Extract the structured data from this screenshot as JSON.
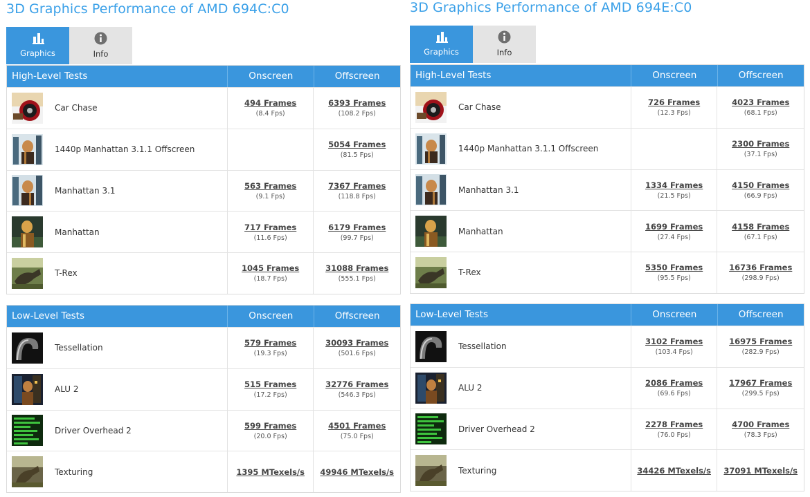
{
  "panels": [
    {
      "title": "3D Graphics Performance of AMD 694C:C0",
      "tabs": [
        {
          "label": "Graphics",
          "icon": "bar-chart-icon"
        },
        {
          "label": "Info",
          "icon": "info-icon"
        }
      ],
      "high": {
        "header": {
          "name": "High-Level Tests",
          "onscreen": "Onscreen",
          "offscreen": "Offscreen"
        },
        "rows": [
          {
            "name": "Car Chase",
            "thumb": "car-chase",
            "on": "494 Frames",
            "on_fps": "(8.4 Fps)",
            "off": "6393 Frames",
            "off_fps": "(108.2 Fps)"
          },
          {
            "name": "1440p Manhattan 3.1.1 Offscreen",
            "thumb": "manhattan311",
            "on": "",
            "on_fps": "",
            "off": "5054 Frames",
            "off_fps": "(81.5 Fps)"
          },
          {
            "name": "Manhattan 3.1",
            "thumb": "manhattan31",
            "on": "563 Frames",
            "on_fps": "(9.1 Fps)",
            "off": "7367 Frames",
            "off_fps": "(118.8 Fps)"
          },
          {
            "name": "Manhattan",
            "thumb": "manhattan",
            "on": "717 Frames",
            "on_fps": "(11.6 Fps)",
            "off": "6179 Frames",
            "off_fps": "(99.7 Fps)"
          },
          {
            "name": "T-Rex",
            "thumb": "trex",
            "on": "1045 Frames",
            "on_fps": "(18.7 Fps)",
            "off": "31088 Frames",
            "off_fps": "(555.1 Fps)"
          }
        ]
      },
      "low": {
        "header": {
          "name": "Low-Level Tests",
          "onscreen": "Onscreen",
          "offscreen": "Offscreen"
        },
        "rows": [
          {
            "name": "Tessellation",
            "thumb": "tessellation",
            "on": "579 Frames",
            "on_fps": "(19.3 Fps)",
            "off": "30093 Frames",
            "off_fps": "(501.6 Fps)"
          },
          {
            "name": "ALU 2",
            "thumb": "alu2",
            "on": "515 Frames",
            "on_fps": "(17.2 Fps)",
            "off": "32776 Frames",
            "off_fps": "(546.3 Fps)"
          },
          {
            "name": "Driver Overhead 2",
            "thumb": "driver",
            "on": "599 Frames",
            "on_fps": "(20.0 Fps)",
            "off": "4501 Frames",
            "off_fps": "(75.0 Fps)"
          },
          {
            "name": "Texturing",
            "thumb": "texturing",
            "on": "1395 MTexels/s",
            "on_fps": "",
            "off": "49946 MTexels/s",
            "off_fps": ""
          }
        ]
      }
    },
    {
      "title": "3D Graphics Performance of AMD 694E:C0",
      "tabs": [
        {
          "label": "Graphics",
          "icon": "bar-chart-icon"
        },
        {
          "label": "Info",
          "icon": "info-icon"
        }
      ],
      "high": {
        "header": {
          "name": "High-Level Tests",
          "onscreen": "Onscreen",
          "offscreen": "Offscreen"
        },
        "rows": [
          {
            "name": "Car Chase",
            "thumb": "car-chase",
            "on": "726 Frames",
            "on_fps": "(12.3 Fps)",
            "off": "4023 Frames",
            "off_fps": "(68.1 Fps)"
          },
          {
            "name": "1440p Manhattan 3.1.1 Offscreen",
            "thumb": "manhattan311",
            "on": "",
            "on_fps": "",
            "off": "2300 Frames",
            "off_fps": "(37.1 Fps)"
          },
          {
            "name": "Manhattan 3.1",
            "thumb": "manhattan31",
            "on": "1334 Frames",
            "on_fps": "(21.5 Fps)",
            "off": "4150 Frames",
            "off_fps": "(66.9 Fps)"
          },
          {
            "name": "Manhattan",
            "thumb": "manhattan",
            "on": "1699 Frames",
            "on_fps": "(27.4 Fps)",
            "off": "4158 Frames",
            "off_fps": "(67.1 Fps)"
          },
          {
            "name": "T-Rex",
            "thumb": "trex",
            "on": "5350 Frames",
            "on_fps": "(95.5 Fps)",
            "off": "16736 Frames",
            "off_fps": "(298.9 Fps)"
          }
        ]
      },
      "low": {
        "header": {
          "name": "Low-Level Tests",
          "onscreen": "Onscreen",
          "offscreen": "Offscreen"
        },
        "rows": [
          {
            "name": "Tessellation",
            "thumb": "tessellation",
            "on": "3102 Frames",
            "on_fps": "(103.4 Fps)",
            "off": "16975 Frames",
            "off_fps": "(282.9 Fps)"
          },
          {
            "name": "ALU 2",
            "thumb": "alu2",
            "on": "2086 Frames",
            "on_fps": "(69.6 Fps)",
            "off": "17967 Frames",
            "off_fps": "(299.5 Fps)"
          },
          {
            "name": "Driver Overhead 2",
            "thumb": "driver",
            "on": "2278 Frames",
            "on_fps": "(76.0 Fps)",
            "off": "4700 Frames",
            "off_fps": "(78.3 Fps)"
          },
          {
            "name": "Texturing",
            "thumb": "texturing",
            "on": "34426 MTexels/s",
            "on_fps": "",
            "off": "37091 MTexels/s",
            "off_fps": ""
          }
        ]
      }
    }
  ],
  "colors": {
    "accent": "#3a96dd",
    "title": "#3aa0e8",
    "tab_inactive": "#e4e4e4"
  }
}
